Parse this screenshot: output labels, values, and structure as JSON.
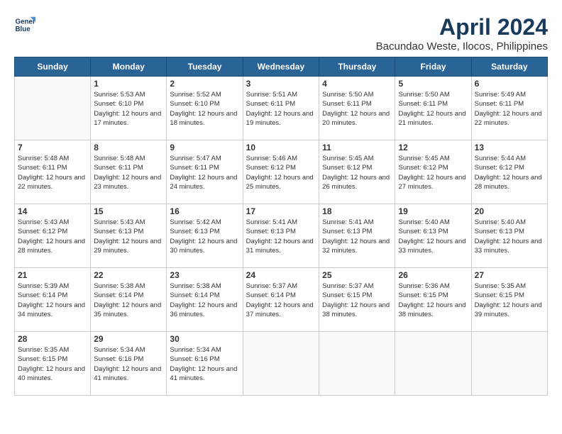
{
  "header": {
    "logo_line1": "General",
    "logo_line2": "Blue",
    "month": "April 2024",
    "location": "Bacundao Weste, Ilocos, Philippines"
  },
  "days_of_week": [
    "Sunday",
    "Monday",
    "Tuesday",
    "Wednesday",
    "Thursday",
    "Friday",
    "Saturday"
  ],
  "weeks": [
    [
      {
        "day": null,
        "info": null
      },
      {
        "day": "1",
        "sunrise": "Sunrise: 5:53 AM",
        "sunset": "Sunset: 6:10 PM",
        "daylight": "Daylight: 12 hours and 17 minutes."
      },
      {
        "day": "2",
        "sunrise": "Sunrise: 5:52 AM",
        "sunset": "Sunset: 6:10 PM",
        "daylight": "Daylight: 12 hours and 18 minutes."
      },
      {
        "day": "3",
        "sunrise": "Sunrise: 5:51 AM",
        "sunset": "Sunset: 6:11 PM",
        "daylight": "Daylight: 12 hours and 19 minutes."
      },
      {
        "day": "4",
        "sunrise": "Sunrise: 5:50 AM",
        "sunset": "Sunset: 6:11 PM",
        "daylight": "Daylight: 12 hours and 20 minutes."
      },
      {
        "day": "5",
        "sunrise": "Sunrise: 5:50 AM",
        "sunset": "Sunset: 6:11 PM",
        "daylight": "Daylight: 12 hours and 21 minutes."
      },
      {
        "day": "6",
        "sunrise": "Sunrise: 5:49 AM",
        "sunset": "Sunset: 6:11 PM",
        "daylight": "Daylight: 12 hours and 22 minutes."
      }
    ],
    [
      {
        "day": "7",
        "sunrise": "Sunrise: 5:48 AM",
        "sunset": "Sunset: 6:11 PM",
        "daylight": "Daylight: 12 hours and 22 minutes."
      },
      {
        "day": "8",
        "sunrise": "Sunrise: 5:48 AM",
        "sunset": "Sunset: 6:11 PM",
        "daylight": "Daylight: 12 hours and 23 minutes."
      },
      {
        "day": "9",
        "sunrise": "Sunrise: 5:47 AM",
        "sunset": "Sunset: 6:11 PM",
        "daylight": "Daylight: 12 hours and 24 minutes."
      },
      {
        "day": "10",
        "sunrise": "Sunrise: 5:46 AM",
        "sunset": "Sunset: 6:12 PM",
        "daylight": "Daylight: 12 hours and 25 minutes."
      },
      {
        "day": "11",
        "sunrise": "Sunrise: 5:45 AM",
        "sunset": "Sunset: 6:12 PM",
        "daylight": "Daylight: 12 hours and 26 minutes."
      },
      {
        "day": "12",
        "sunrise": "Sunrise: 5:45 AM",
        "sunset": "Sunset: 6:12 PM",
        "daylight": "Daylight: 12 hours and 27 minutes."
      },
      {
        "day": "13",
        "sunrise": "Sunrise: 5:44 AM",
        "sunset": "Sunset: 6:12 PM",
        "daylight": "Daylight: 12 hours and 28 minutes."
      }
    ],
    [
      {
        "day": "14",
        "sunrise": "Sunrise: 5:43 AM",
        "sunset": "Sunset: 6:12 PM",
        "daylight": "Daylight: 12 hours and 28 minutes."
      },
      {
        "day": "15",
        "sunrise": "Sunrise: 5:43 AM",
        "sunset": "Sunset: 6:13 PM",
        "daylight": "Daylight: 12 hours and 29 minutes."
      },
      {
        "day": "16",
        "sunrise": "Sunrise: 5:42 AM",
        "sunset": "Sunset: 6:13 PM",
        "daylight": "Daylight: 12 hours and 30 minutes."
      },
      {
        "day": "17",
        "sunrise": "Sunrise: 5:41 AM",
        "sunset": "Sunset: 6:13 PM",
        "daylight": "Daylight: 12 hours and 31 minutes."
      },
      {
        "day": "18",
        "sunrise": "Sunrise: 5:41 AM",
        "sunset": "Sunset: 6:13 PM",
        "daylight": "Daylight: 12 hours and 32 minutes."
      },
      {
        "day": "19",
        "sunrise": "Sunrise: 5:40 AM",
        "sunset": "Sunset: 6:13 PM",
        "daylight": "Daylight: 12 hours and 33 minutes."
      },
      {
        "day": "20",
        "sunrise": "Sunrise: 5:40 AM",
        "sunset": "Sunset: 6:13 PM",
        "daylight": "Daylight: 12 hours and 33 minutes."
      }
    ],
    [
      {
        "day": "21",
        "sunrise": "Sunrise: 5:39 AM",
        "sunset": "Sunset: 6:14 PM",
        "daylight": "Daylight: 12 hours and 34 minutes."
      },
      {
        "day": "22",
        "sunrise": "Sunrise: 5:38 AM",
        "sunset": "Sunset: 6:14 PM",
        "daylight": "Daylight: 12 hours and 35 minutes."
      },
      {
        "day": "23",
        "sunrise": "Sunrise: 5:38 AM",
        "sunset": "Sunset: 6:14 PM",
        "daylight": "Daylight: 12 hours and 36 minutes."
      },
      {
        "day": "24",
        "sunrise": "Sunrise: 5:37 AM",
        "sunset": "Sunset: 6:14 PM",
        "daylight": "Daylight: 12 hours and 37 minutes."
      },
      {
        "day": "25",
        "sunrise": "Sunrise: 5:37 AM",
        "sunset": "Sunset: 6:15 PM",
        "daylight": "Daylight: 12 hours and 38 minutes."
      },
      {
        "day": "26",
        "sunrise": "Sunrise: 5:36 AM",
        "sunset": "Sunset: 6:15 PM",
        "daylight": "Daylight: 12 hours and 38 minutes."
      },
      {
        "day": "27",
        "sunrise": "Sunrise: 5:35 AM",
        "sunset": "Sunset: 6:15 PM",
        "daylight": "Daylight: 12 hours and 39 minutes."
      }
    ],
    [
      {
        "day": "28",
        "sunrise": "Sunrise: 5:35 AM",
        "sunset": "Sunset: 6:15 PM",
        "daylight": "Daylight: 12 hours and 40 minutes."
      },
      {
        "day": "29",
        "sunrise": "Sunrise: 5:34 AM",
        "sunset": "Sunset: 6:16 PM",
        "daylight": "Daylight: 12 hours and 41 minutes."
      },
      {
        "day": "30",
        "sunrise": "Sunrise: 5:34 AM",
        "sunset": "Sunset: 6:16 PM",
        "daylight": "Daylight: 12 hours and 41 minutes."
      },
      {
        "day": null,
        "info": null
      },
      {
        "day": null,
        "info": null
      },
      {
        "day": null,
        "info": null
      },
      {
        "day": null,
        "info": null
      }
    ]
  ]
}
